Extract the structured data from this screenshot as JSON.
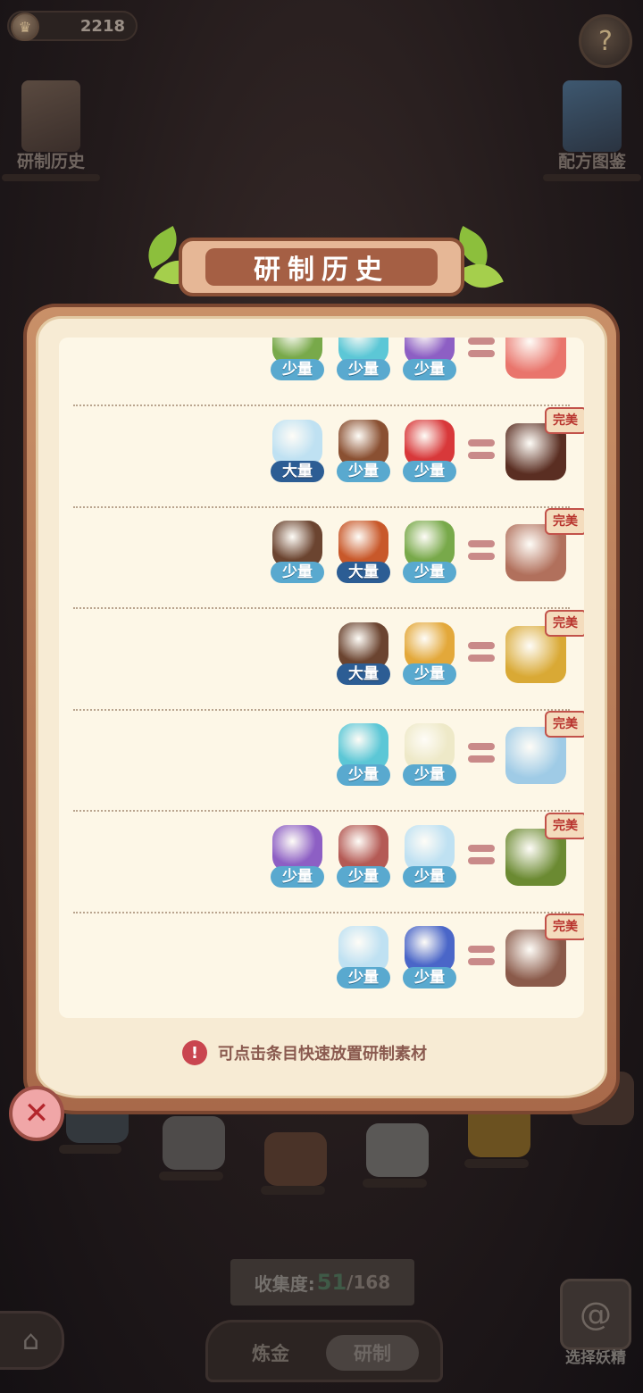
{
  "hud": {
    "coins": "2218",
    "coin_icon": "crown-coin-icon",
    "help_icon": "leaf-help-icon"
  },
  "side_buttons": {
    "history_label": "研制历史",
    "recipe_label": "配方图鉴"
  },
  "modal": {
    "title": "研制历史",
    "hint": "可点击条目快速放置研制素材",
    "perfect_label": "完美",
    "rows": [
      {
        "ingredients": [
          {
            "icon": "grass-icon",
            "qty": "少量",
            "size": "small",
            "color": "#78a94a"
          },
          {
            "icon": "water-pool-icon",
            "qty": "少量",
            "size": "small",
            "color": "#5cc7d6"
          },
          {
            "icon": "purple-flower-icon",
            "qty": "少量",
            "size": "small",
            "color": "#8d5fc4"
          }
        ],
        "result": {
          "icon": "red-jam-bowl-icon",
          "color": "#e9756c"
        },
        "perfect": false
      },
      {
        "ingredients": [
          {
            "icon": "salt-crystal-icon",
            "qty": "大量",
            "size": "large",
            "color": "#bfe1f2"
          },
          {
            "icon": "chocolate-bar-icon",
            "qty": "少量",
            "size": "small",
            "color": "#8a5032"
          },
          {
            "icon": "tomato-icon",
            "qty": "少量",
            "size": "small",
            "color": "#d8383a"
          }
        ],
        "result": {
          "icon": "chocolate-balls-icon",
          "color": "#5a2e22"
        },
        "perfect": true
      },
      {
        "ingredients": [
          {
            "icon": "dirt-pile-icon",
            "qty": "少量",
            "size": "small",
            "color": "#6b4430"
          },
          {
            "icon": "fire-rock-icon",
            "qty": "大量",
            "size": "large",
            "color": "#c8582a"
          },
          {
            "icon": "grass-icon",
            "qty": "少量",
            "size": "small",
            "color": "#78a94a"
          }
        ],
        "result": {
          "icon": "brick-cube-icon",
          "color": "#b1705c"
        },
        "perfect": true
      },
      {
        "ingredients": [
          {
            "icon": "dirt-pile-icon",
            "qty": "大量",
            "size": "large",
            "color": "#6b4430"
          },
          {
            "icon": "golden-wheat-icon",
            "qty": "少量",
            "size": "small",
            "color": "#e3a83a"
          }
        ],
        "result": {
          "icon": "gold-sand-icon",
          "color": "#d9a935"
        },
        "perfect": true
      },
      {
        "ingredients": [
          {
            "icon": "water-pool-icon",
            "qty": "少量",
            "size": "small",
            "color": "#5cc7d6"
          },
          {
            "icon": "white-lily-icon",
            "qty": "少量",
            "size": "small",
            "color": "#eee9c8"
          }
        ],
        "result": {
          "icon": "rain-cloud-icon",
          "color": "#9fcbe6"
        },
        "perfect": true
      },
      {
        "ingredients": [
          {
            "icon": "purple-flower-icon",
            "qty": "少量",
            "size": "small",
            "color": "#8d5fc4"
          },
          {
            "icon": "thorny-branch-icon",
            "qty": "少量",
            "size": "small",
            "color": "#b45a55"
          },
          {
            "icon": "salt-crystal-icon",
            "qty": "少量",
            "size": "small",
            "color": "#bfe1f2"
          }
        ],
        "result": {
          "icon": "vine-sword-icon",
          "color": "#6b8a32"
        },
        "perfect": true
      },
      {
        "ingredients": [
          {
            "icon": "salt-crystal-icon",
            "qty": "少量",
            "size": "small",
            "color": "#bfe1f2"
          },
          {
            "icon": "blue-jelly-icon",
            "qty": "少量",
            "size": "small",
            "color": "#4a66c8"
          }
        ],
        "result": {
          "icon": "mortar-bowl-icon",
          "color": "#8a5a4a"
        },
        "perfect": true
      }
    ]
  },
  "bottom": {
    "collect_label": "收集度:",
    "collect_value": "51",
    "collect_total": "/168",
    "tab_alchemy": "炼金",
    "tab_research": "研制",
    "sprite_label": "选择妖精",
    "home_icon": "home-icon",
    "close_icon": "close-icon"
  }
}
